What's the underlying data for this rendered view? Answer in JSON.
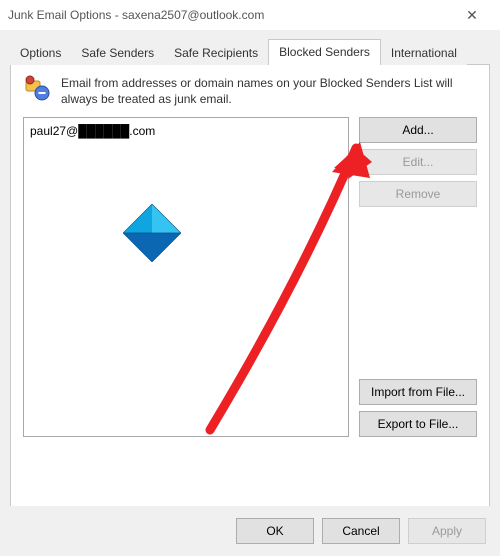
{
  "window": {
    "title": "Junk Email Options - saxena2507@outlook.com",
    "close_glyph": "✕"
  },
  "tabs": {
    "options": "Options",
    "safe_senders": "Safe Senders",
    "safe_recipients": "Safe Recipients",
    "blocked_senders": "Blocked Senders",
    "international": "International"
  },
  "active_tab": "blocked_senders",
  "panel": {
    "description": "Email from addresses or domain names on your Blocked Senders List will always be treated as junk email.",
    "list_items": [
      "paul27@██████.com"
    ],
    "buttons": {
      "add": "Add...",
      "edit": "Edit...",
      "remove": "Remove",
      "import": "Import from File...",
      "export": "Export to File..."
    }
  },
  "dialog_buttons": {
    "ok": "OK",
    "cancel": "Cancel",
    "apply": "Apply"
  },
  "colors": {
    "arrow": "#ed2024",
    "logo_light": "#35c3f2",
    "logo_dark": "#0b66b3"
  }
}
